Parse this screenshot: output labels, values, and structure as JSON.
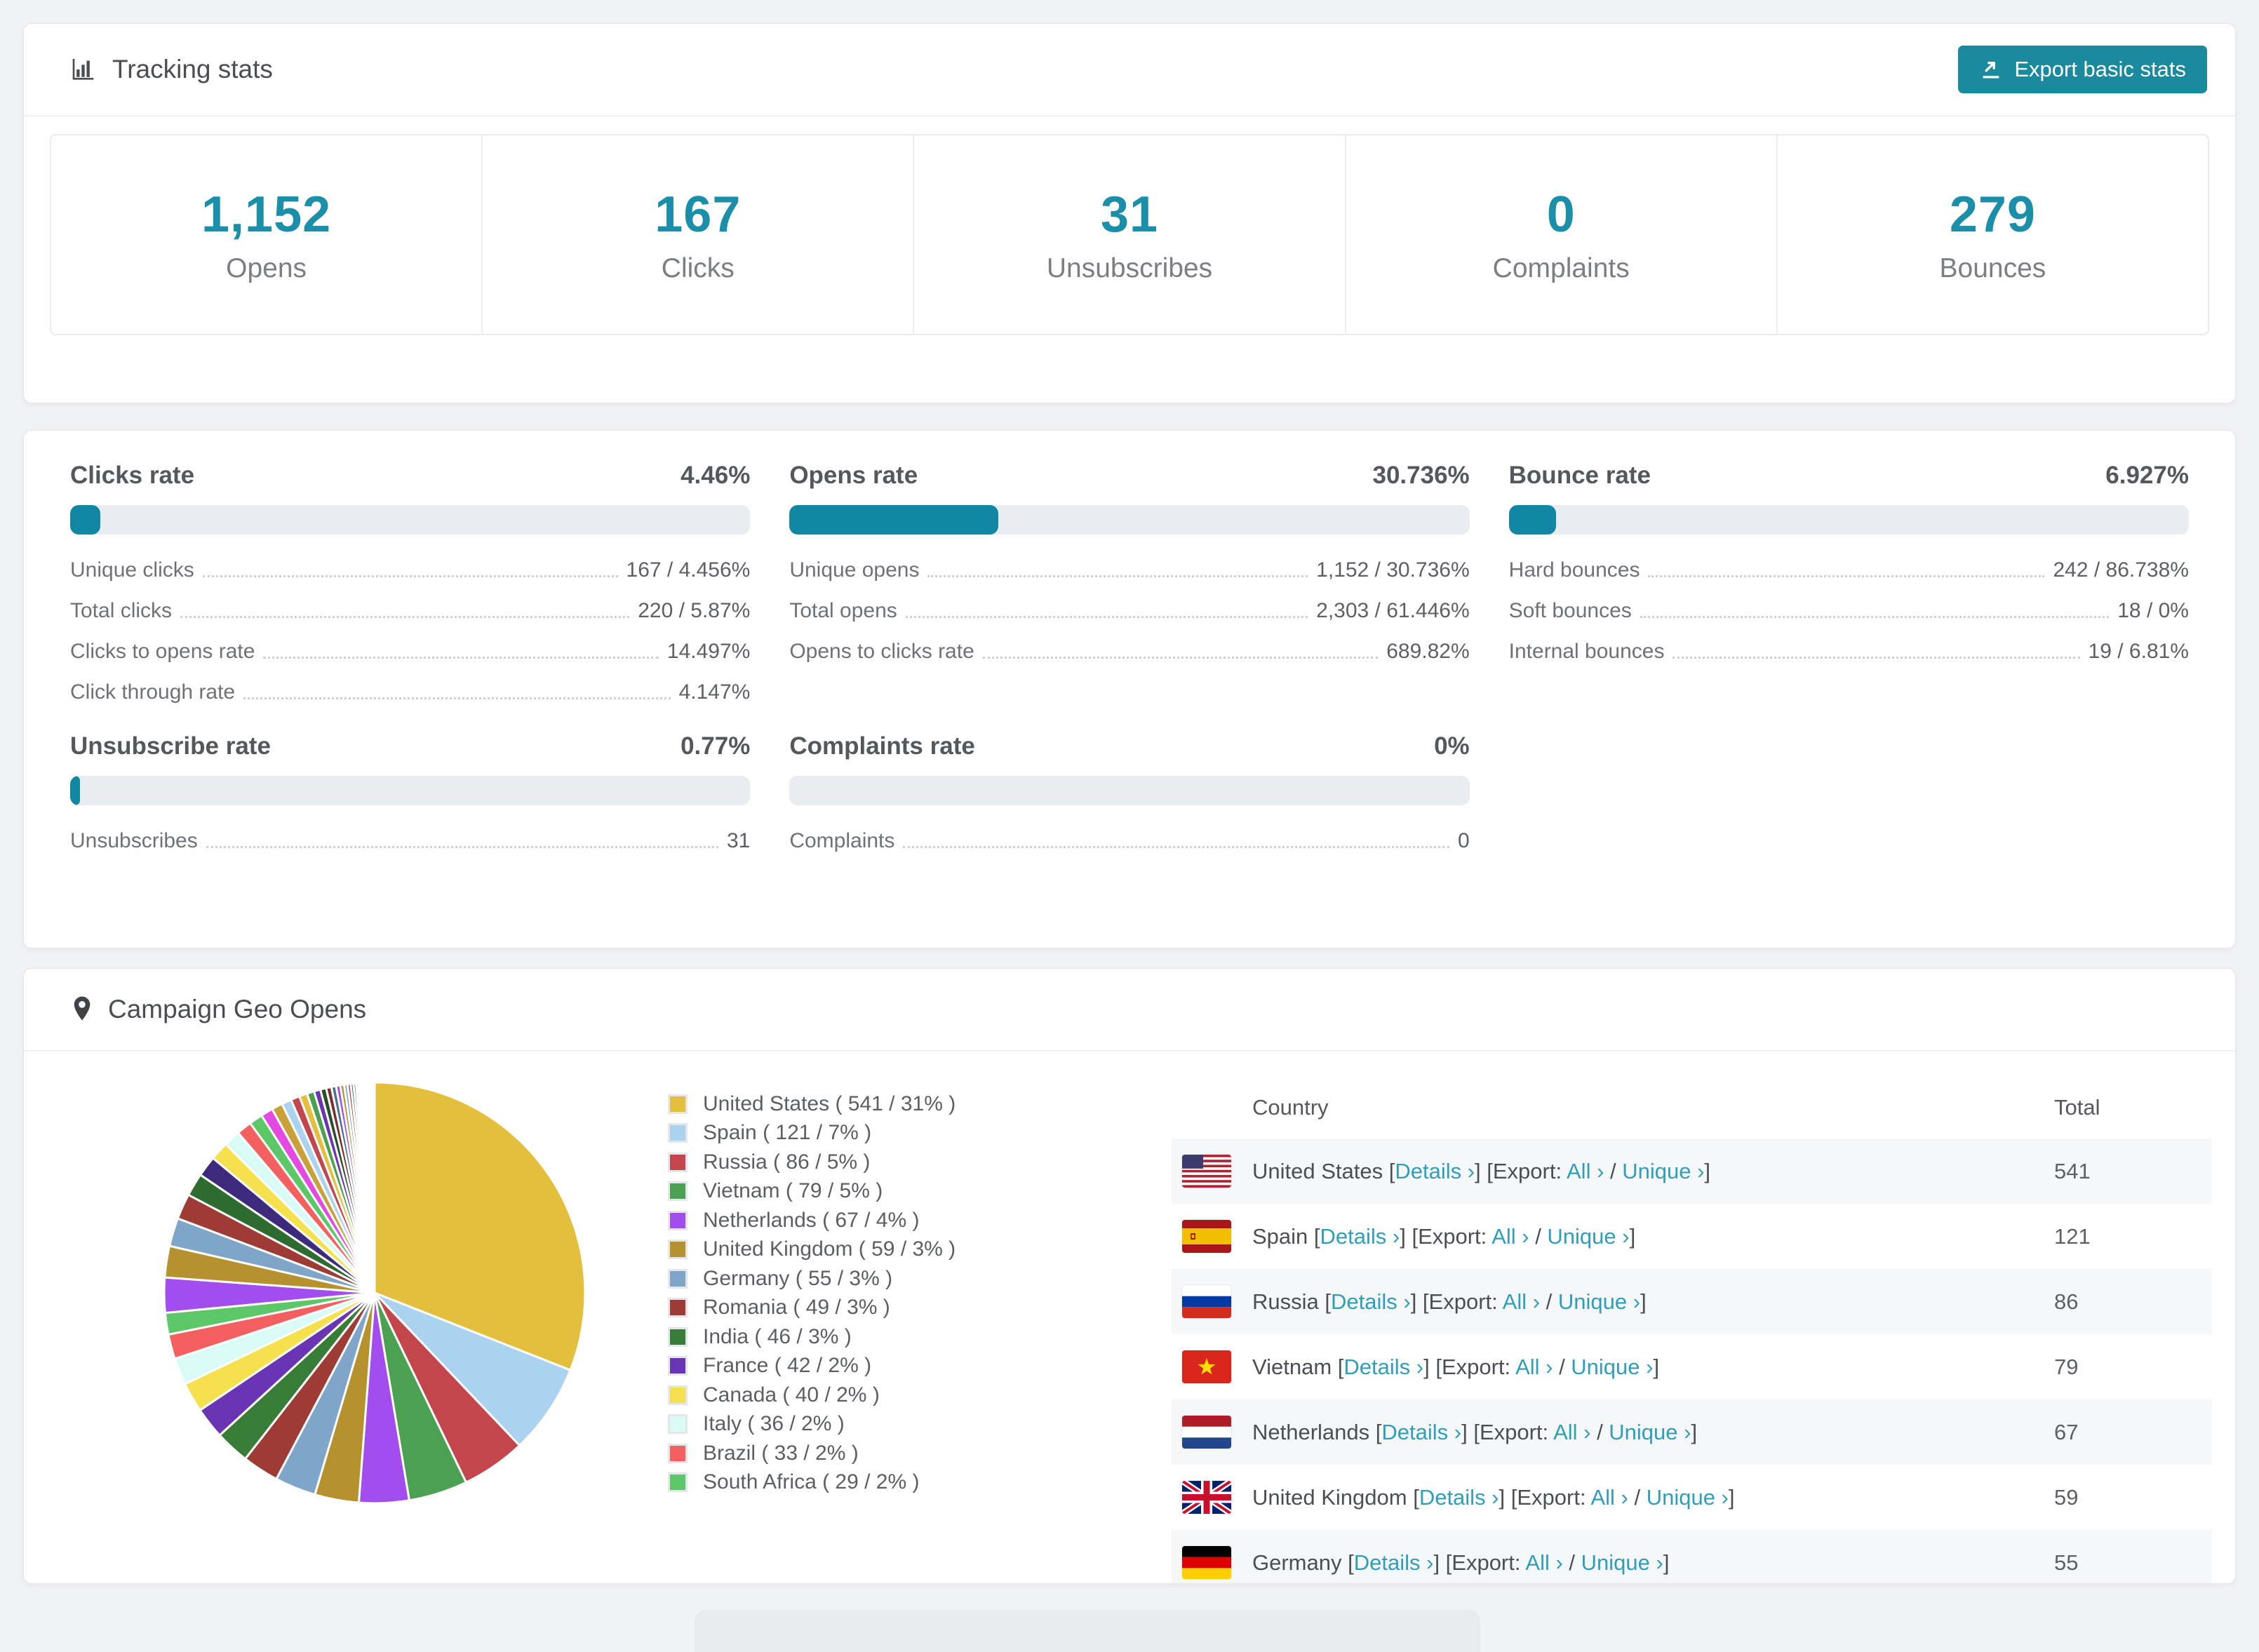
{
  "colors": {
    "accent": "#1b8a9e",
    "stat_number": "#1b8fa9",
    "link": "#2f9eba",
    "bar_fill": "#1287a3",
    "bar_track": "#e9ecf0"
  },
  "tracking": {
    "title": "Tracking stats",
    "export_button": "Export basic stats",
    "stats": [
      {
        "value": "1,152",
        "label": "Opens"
      },
      {
        "value": "167",
        "label": "Clicks"
      },
      {
        "value": "31",
        "label": "Unsubscribes"
      },
      {
        "value": "0",
        "label": "Complaints"
      },
      {
        "value": "279",
        "label": "Bounces"
      }
    ]
  },
  "rates": [
    {
      "title": "Clicks rate",
      "display": "4.46%",
      "percent": 4.46,
      "rows": [
        [
          "Unique clicks",
          "167 / 4.456%"
        ],
        [
          "Total clicks",
          "220 / 5.87%"
        ],
        [
          "Clicks to opens rate",
          "14.497%"
        ],
        [
          "Click through rate",
          "4.147%"
        ]
      ]
    },
    {
      "title": "Opens rate",
      "display": "30.736%",
      "percent": 30.736,
      "rows": [
        [
          "Unique opens",
          "1,152 / 30.736%"
        ],
        [
          "Total opens",
          "2,303 / 61.446%"
        ],
        [
          "Opens to clicks rate",
          "689.82%"
        ]
      ]
    },
    {
      "title": "Bounce rate",
      "display": "6.927%",
      "percent": 6.927,
      "rows": [
        [
          "Hard bounces",
          "242 / 86.738%"
        ],
        [
          "Soft bounces",
          "18 / 0%"
        ],
        [
          "Internal bounces",
          "19 / 6.81%"
        ]
      ]
    },
    {
      "title": "Unsubscribe rate",
      "display": "0.77%",
      "percent": 0.77,
      "rows": [
        [
          "Unsubscribes",
          "31"
        ]
      ]
    },
    {
      "title": "Complaints rate",
      "display": "0%",
      "percent": 0,
      "rows": [
        [
          "Complaints",
          "0"
        ]
      ]
    }
  ],
  "geo": {
    "title": "Campaign Geo Opens",
    "table_headers": {
      "country": "Country",
      "total": "Total"
    },
    "links": {
      "details": "Details",
      "export": "Export:",
      "all": "All",
      "unique": "Unique",
      "chevron": "›"
    },
    "rows": [
      {
        "country": "United States",
        "flag": "us",
        "total": "541"
      },
      {
        "country": "Spain",
        "flag": "es",
        "total": "121"
      },
      {
        "country": "Russia",
        "flag": "ru",
        "total": "86"
      },
      {
        "country": "Vietnam",
        "flag": "vn",
        "total": "79"
      },
      {
        "country": "Netherlands",
        "flag": "nl",
        "total": "67"
      },
      {
        "country": "United Kingdom",
        "flag": "gb",
        "total": "59"
      },
      {
        "country": "Germany",
        "flag": "de",
        "total": "55"
      }
    ]
  },
  "chart_data": {
    "type": "pie",
    "title": "Campaign Geo Opens",
    "legend_position": "right",
    "series": [
      {
        "name": "United States",
        "value": 541,
        "pct": 31,
        "color": "#e3bf3d"
      },
      {
        "name": "Spain",
        "value": 121,
        "pct": 7,
        "color": "#abd3f0"
      },
      {
        "name": "Russia",
        "value": 86,
        "pct": 5,
        "color": "#c2464b"
      },
      {
        "name": "Vietnam",
        "value": 79,
        "pct": 5,
        "color": "#4ba052"
      },
      {
        "name": "Netherlands",
        "value": 67,
        "pct": 4,
        "color": "#a34def"
      },
      {
        "name": "United Kingdom",
        "value": 59,
        "pct": 3,
        "color": "#b5922e"
      },
      {
        "name": "Germany",
        "value": 55,
        "pct": 3,
        "color": "#7fa5c9"
      },
      {
        "name": "Romania",
        "value": 49,
        "pct": 3,
        "color": "#9e3b35"
      },
      {
        "name": "India",
        "value": 46,
        "pct": 3,
        "color": "#377d37"
      },
      {
        "name": "France",
        "value": 42,
        "pct": 2,
        "color": "#6a35b5"
      },
      {
        "name": "Canada",
        "value": 40,
        "pct": 2,
        "color": "#f5e04e"
      },
      {
        "name": "Italy",
        "value": 36,
        "pct": 2,
        "color": "#d8fbf7"
      },
      {
        "name": "Brazil",
        "value": 33,
        "pct": 2,
        "color": "#f4605f"
      },
      {
        "name": "South Africa",
        "value": 29,
        "pct": 2,
        "color": "#5bc766"
      }
    ],
    "others": {
      "total": 463,
      "count": 42,
      "decay": 0.9
    },
    "other_colors": [
      "#a34def",
      "#b5922e",
      "#7fa5c9",
      "#9e3b35",
      "#2e6b2e",
      "#3d2a7d",
      "#f5e04e",
      "#d8fbf7",
      "#f4605f",
      "#5bc766",
      "#e44ae2",
      "#c9a13b",
      "#abd3f0",
      "#c2464b",
      "#e3bf3d",
      "#4ba052",
      "#6a35b5",
      "#274e27",
      "#7a2e2a",
      "#4b6f8e"
    ]
  }
}
